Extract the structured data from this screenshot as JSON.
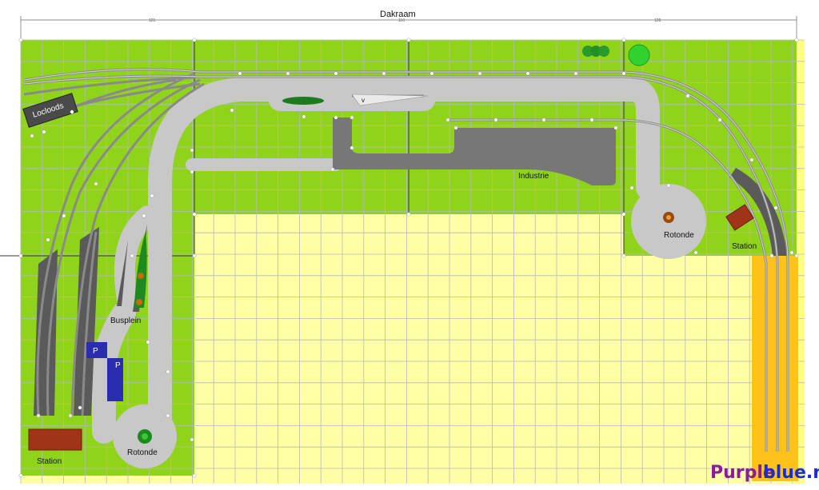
{
  "title": "Dakraam",
  "dimensions": [
    "121",
    "110",
    "128"
  ],
  "labels": {
    "locloods": "Locloods",
    "industrie": "Industrie",
    "rotonde_right": "Rotonde",
    "station_right": "Station",
    "busplein": "Busplein",
    "parking_1": "P",
    "parking_2": "P",
    "station_left": "Station",
    "rotonde_left": "Rotonde",
    "sign_v": "v"
  },
  "watermark": {
    "part1": "Purple",
    "part2": "blue.nl"
  },
  "colors": {
    "grass": "#8fd41a",
    "sand": "#ffffa6",
    "road": "#c8c8c8",
    "asphalt": "#777777",
    "platform_yellow": "#ffc21a",
    "station_roof": "#a13418",
    "parking_blue": "#2b2db0",
    "grid": "#b8b8b8",
    "track": "#8a8a8a"
  }
}
